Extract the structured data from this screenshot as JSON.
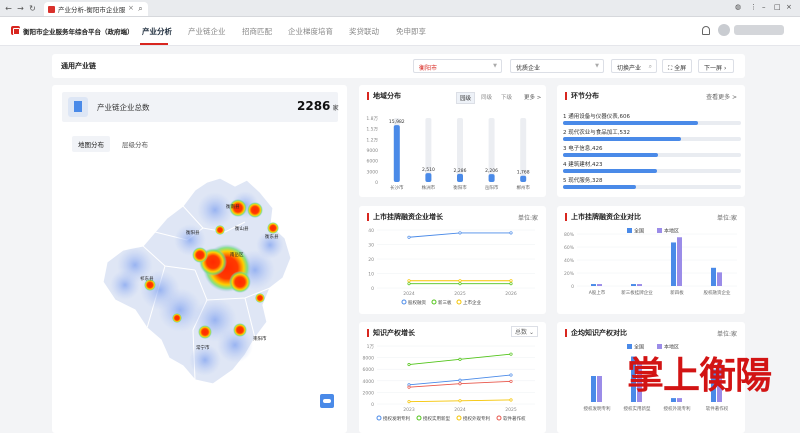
{
  "browser": {
    "tab_title": "产业分析-衡阳市企业服",
    "close_glyph": "×",
    "back_glyph": "←",
    "forward_glyph": "→",
    "reload_glyph": "↻",
    "search_glyph": "⌕"
  },
  "header": {
    "brand": "衡阳市企业服务年综合平台（政府端）",
    "nav": [
      "产业分析",
      "产业链企业",
      "招商匹配",
      "企业梯度培育",
      "奖贷联动",
      "免申即享"
    ],
    "active_nav": "产业分析"
  },
  "filterbar": {
    "title": "通用产业链",
    "region": "衡阳市",
    "category": "优质企业",
    "switch_label": "切换产业",
    "fullscreen_label": "全屏",
    "next_label": "下一屏",
    "caret": "▼"
  },
  "left": {
    "total_label": "产业链企业总数",
    "total_value": "2286",
    "total_unit": "家",
    "tabs": [
      "地图分布",
      "层级分布"
    ],
    "active_tab": "地图分布",
    "places": [
      "衡阳县",
      "衡南县",
      "祁东县",
      "衡东县",
      "耒阳市",
      "常宁市",
      "衡山县",
      "南岳区"
    ]
  },
  "region_dist": {
    "title": "地域分布",
    "segments": [
      "园级",
      "同级",
      "下级"
    ],
    "active_segment": "园级",
    "more": "更多 >"
  },
  "links": {
    "title": "环节分布",
    "more": "查看更多 >",
    "items": [
      {
        "rank": "1",
        "name": "通用设备与仪器仪表",
        "value": 606
      },
      {
        "rank": "2",
        "name": "现代农业与食品加工",
        "value": 532
      },
      {
        "rank": "3",
        "name": "电子信息",
        "value": 426
      },
      {
        "rank": "4",
        "name": "建筑建材",
        "value": 423
      },
      {
        "rank": "5",
        "name": "现代服务",
        "value": 328
      }
    ]
  },
  "listed": {
    "title": "上市挂牌融资企业增长",
    "unit": "单位:家"
  },
  "listed_compare": {
    "title": "上市挂牌融资企业对比",
    "unit": "单位:家"
  },
  "ip": {
    "title": "知识产权增长",
    "dropdown": "总数"
  },
  "ip_avg": {
    "title": "企均知识产权对比",
    "unit": "单位:家"
  },
  "watermark": "掌上衡陽",
  "chart_data": [
    {
      "type": "bar",
      "id": "region",
      "categories": [
        "长沙市",
        "株洲市",
        "衡阳市",
        "岳阳市",
        "郴州市"
      ],
      "values": [
        15982,
        2510,
        2286,
        2206,
        1768
      ],
      "yticks": [
        "1.8万",
        "1.5万",
        "1.2万",
        "9000",
        "6000",
        "3000",
        "0"
      ],
      "ylim": [
        0,
        18000
      ]
    },
    {
      "type": "line",
      "id": "listed_growth",
      "x": [
        "2024",
        "2025",
        "2026"
      ],
      "series": [
        {
          "name": "股权融资",
          "values": [
            35,
            38,
            38
          ],
          "color": "#4a8ae8"
        },
        {
          "name": "新三板",
          "values": [
            3,
            3,
            3
          ],
          "color": "#52c41a"
        },
        {
          "name": "上市企业",
          "values": [
            5,
            5,
            5
          ],
          "color": "#f5c400"
        }
      ],
      "yticks": [
        "40",
        "30",
        "20",
        "10",
        "0"
      ],
      "ylim": [
        0,
        40
      ]
    },
    {
      "type": "bar",
      "id": "listed_compare",
      "categories": [
        "A股上市",
        "新三板挂牌企业",
        "新四板",
        "股权融资企业"
      ],
      "series": [
        {
          "name": "全国",
          "values": [
            3,
            3,
            67,
            28
          ],
          "color": "#4a8ae8"
        },
        {
          "name": "本地区",
          "values": [
            3,
            3,
            75,
            21
          ],
          "color": "#9b8ce8"
        }
      ],
      "yticks": [
        "80%",
        "60%",
        "40%",
        "20%",
        "0"
      ],
      "ylim": [
        0,
        80
      ]
    },
    {
      "type": "line",
      "id": "ip_growth",
      "x": [
        "2023",
        "2024",
        "2025"
      ],
      "series": [
        {
          "name": "授权发明专利",
          "values": [
            3300,
            4100,
            5000
          ],
          "color": "#4a8ae8"
        },
        {
          "name": "授权实用新型",
          "values": [
            6800,
            7700,
            8600
          ],
          "color": "#52c41a"
        },
        {
          "name": "授权外观专利",
          "values": [
            400,
            550,
            700
          ],
          "color": "#f5c400"
        },
        {
          "name": "软件著作权",
          "values": [
            2900,
            3500,
            3900
          ],
          "color": "#e8564a"
        }
      ],
      "yticks": [
        "1万",
        "8000",
        "6000",
        "4000",
        "2000",
        "0"
      ],
      "ylim": [
        0,
        10000
      ]
    },
    {
      "type": "bar",
      "id": "ip_avg",
      "categories": [
        "授权发明专利",
        "授权实用新型",
        "授权外观专利",
        "软件著作权"
      ],
      "series": [
        {
          "name": "全国",
          "values": [
            20,
            35,
            3,
            25
          ],
          "color": "#4a8ae8"
        },
        {
          "name": "本地区",
          "values": [
            20,
            30,
            3,
            30
          ],
          "color": "#9b8ce8"
        }
      ]
    }
  ]
}
